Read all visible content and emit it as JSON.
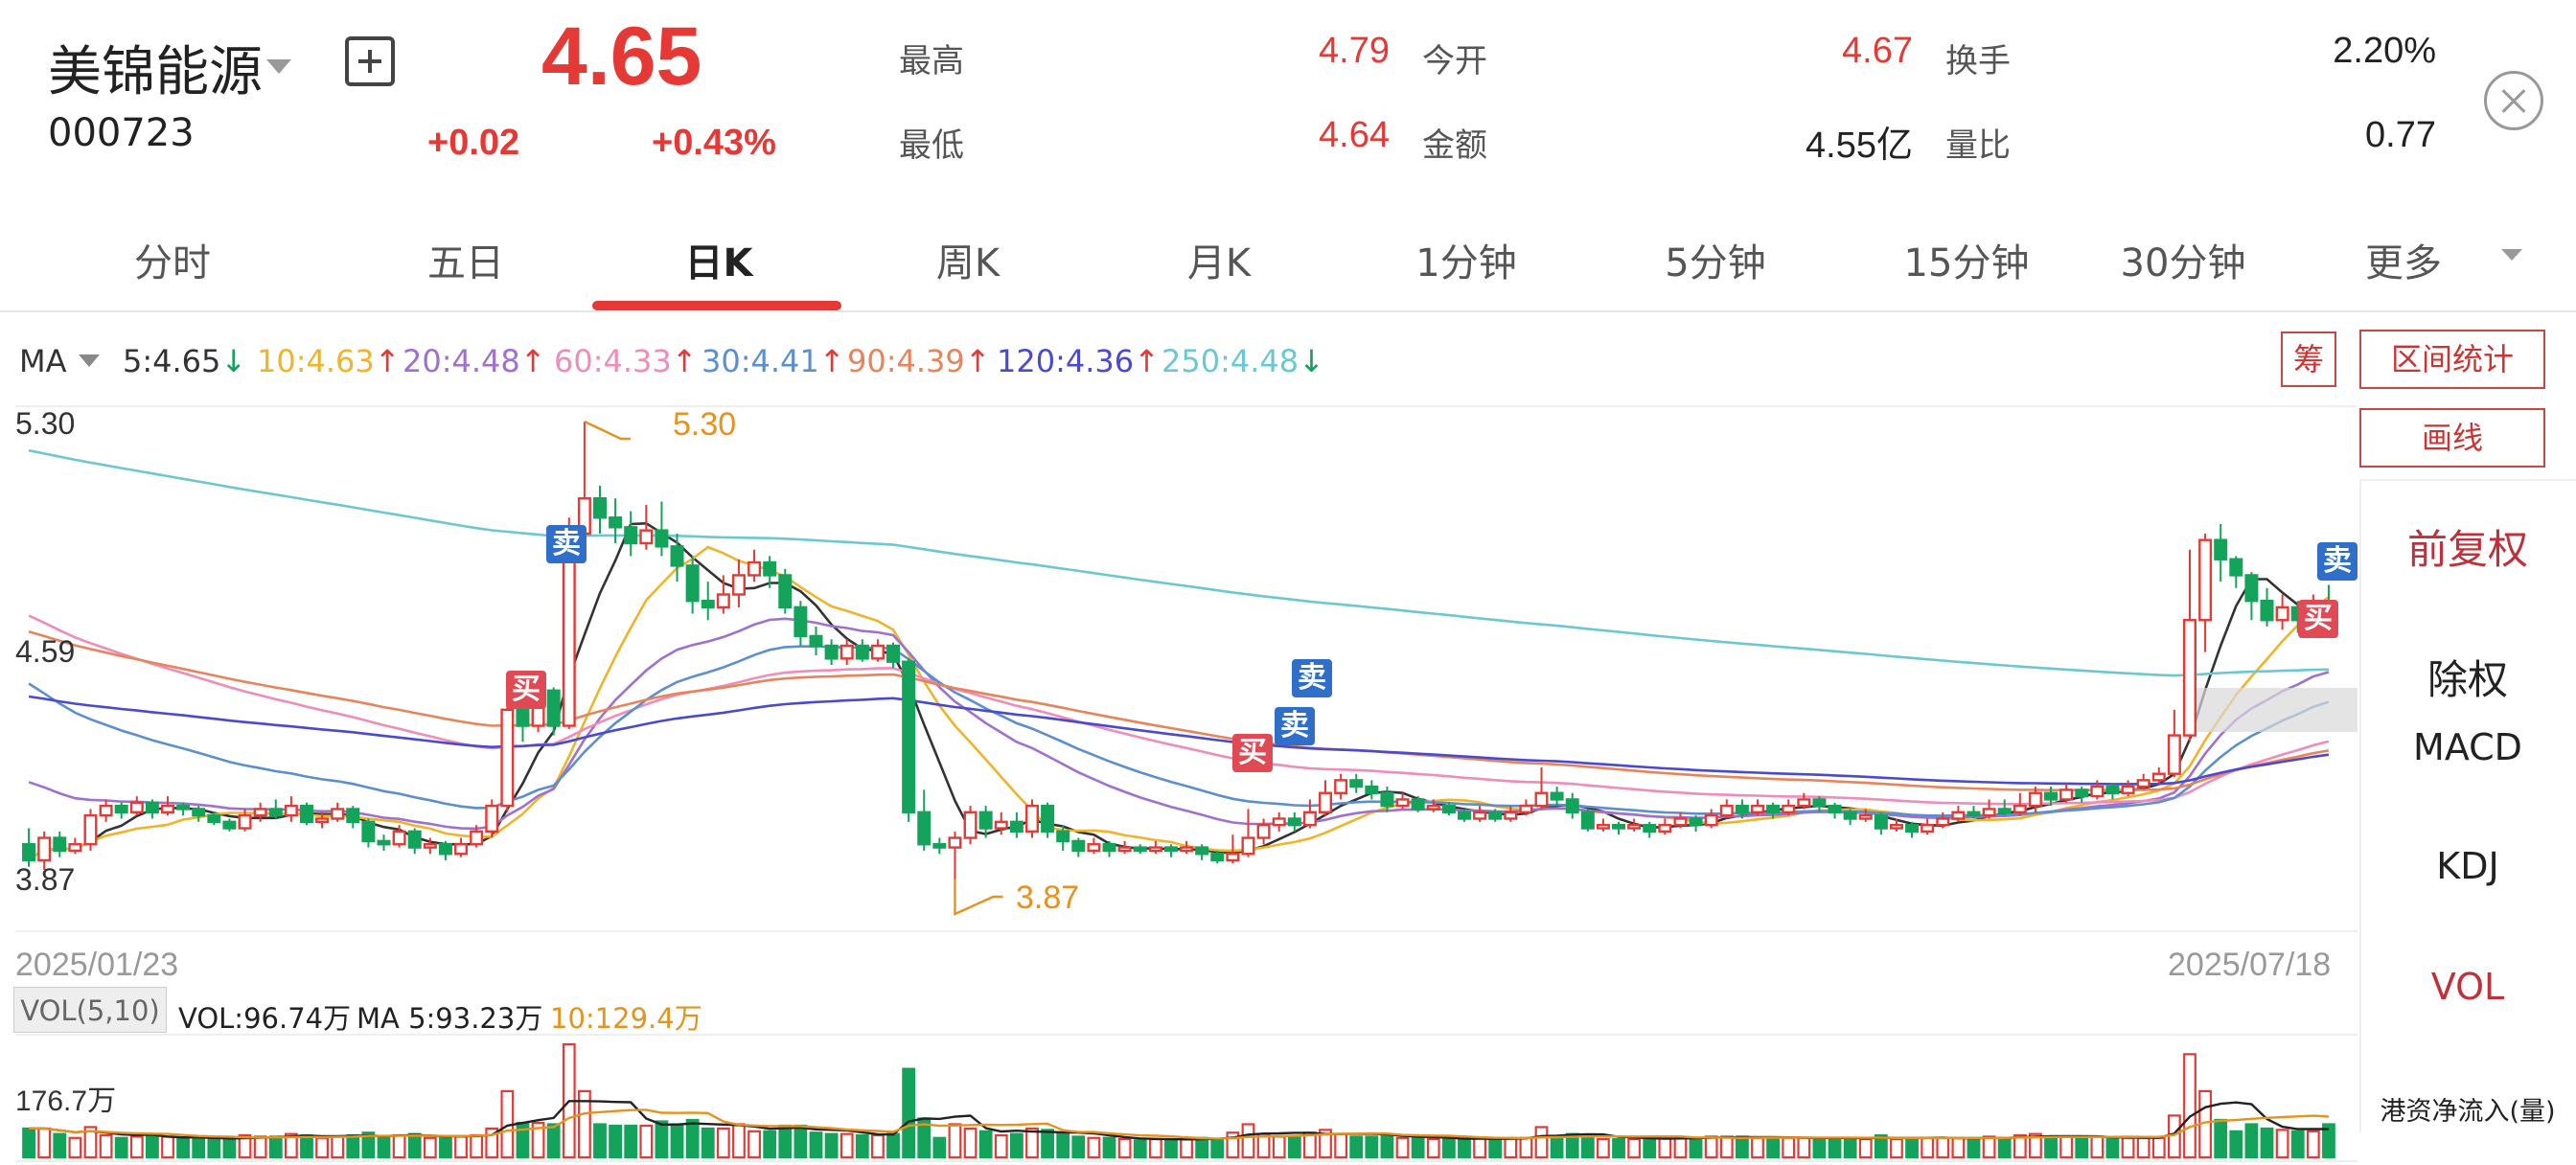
{
  "stock": {
    "name": "美锦能源",
    "code": "000723",
    "price": "4.65",
    "change": "+0.02",
    "change_pct": "+0.43%"
  },
  "stats": [
    {
      "label": "最高",
      "value": "4.79",
      "color": "#e53935"
    },
    {
      "label": "今开",
      "value": "4.67",
      "color": "#e53935"
    },
    {
      "label": "换手",
      "value": "2.20%",
      "color": "#222222"
    },
    {
      "label": "最低",
      "value": "4.64",
      "color": "#e53935"
    },
    {
      "label": "金额",
      "value": "4.55亿",
      "color": "#222222"
    },
    {
      "label": "量比",
      "value": "0.77",
      "color": "#222222"
    }
  ],
  "tabs": [
    "分时",
    "五日",
    "日K",
    "周K",
    "月K",
    "1分钟",
    "5分钟",
    "15分钟",
    "30分钟",
    "更多"
  ],
  "active_tab": "日K",
  "ma_legend": {
    "label": "MA",
    "items": [
      {
        "text": "5:4.65",
        "arrow": "↓",
        "color": "#333333",
        "arrow_color": "#13a35a"
      },
      {
        "text": "10:4.63",
        "arrow": "↑",
        "color": "#f0b429",
        "arrow_color": "#e53935"
      },
      {
        "text": "20:4.48",
        "arrow": "↑",
        "color": "#a070d0",
        "arrow_color": "#e53935"
      },
      {
        "text": "60:4.33",
        "arrow": "↑",
        "color": "#f08cb8",
        "arrow_color": "#e53935"
      },
      {
        "text": "30:4.41",
        "arrow": "↑",
        "color": "#5b8fd0",
        "arrow_color": "#e53935"
      },
      {
        "text": "90:4.39",
        "arrow": "↑",
        "color": "#e8845a",
        "arrow_color": "#e53935"
      },
      {
        "text": "120:4.36",
        "arrow": "↑",
        "color": "#4a4ad0",
        "arrow_color": "#e53935"
      },
      {
        "text": "250:4.48",
        "arrow": "↓",
        "color": "#6cc8d0",
        "arrow_color": "#13a35a"
      }
    ]
  },
  "side_buttons": {
    "chip": "筹",
    "range_stats": "区间统计",
    "draw": "画线"
  },
  "side_menu": [
    {
      "label": "前复权",
      "color": "#c0303a"
    },
    {
      "label": "除权",
      "color": "#222222"
    },
    {
      "label": "MACD",
      "color": "#222222"
    },
    {
      "label": "KDJ",
      "color": "#222222"
    },
    {
      "label": "VOL",
      "color": "#c0303a"
    },
    {
      "label": "港资净流入(量)",
      "color": "#222222"
    }
  ],
  "axis": {
    "y_top": "5.30",
    "y_mid": "4.59",
    "y_bottom": "3.87",
    "date_start": "2025/01/23",
    "date_end": "2025/07/18",
    "max_label": "5.30",
    "min_label": "3.87"
  },
  "volume": {
    "badge": "VOL(5,10)",
    "vol": "VOL:96.74万",
    "ma5": "MA 5:93.23万",
    "ma10": "10:129.4万",
    "y_label": "176.7万"
  },
  "markers": {
    "sell": "卖",
    "buy": "买"
  },
  "colors": {
    "up": "#e53935",
    "down": "#13a35a",
    "accent": "#e53935"
  },
  "chart_data": {
    "type": "candlestick",
    "date_range": [
      "2025/01/23",
      "2025/07/18"
    ],
    "ylim": [
      3.87,
      5.3
    ],
    "candles": [
      [
        3.98,
        3.93,
        4.03,
        3.91
      ],
      [
        3.93,
        4.0,
        4.02,
        3.9
      ],
      [
        4.0,
        3.96,
        4.02,
        3.94
      ],
      [
        3.96,
        3.98,
        4.0,
        3.95
      ],
      [
        3.98,
        4.07,
        4.09,
        3.96
      ],
      [
        4.07,
        4.1,
        4.12,
        4.05
      ],
      [
        4.1,
        4.08,
        4.11,
        4.06
      ],
      [
        4.08,
        4.11,
        4.13,
        4.07
      ],
      [
        4.11,
        4.08,
        4.12,
        4.06
      ],
      [
        4.08,
        4.1,
        4.13,
        4.07
      ],
      [
        4.1,
        4.09,
        4.11,
        4.07
      ],
      [
        4.09,
        4.07,
        4.1,
        4.05
      ],
      [
        4.07,
        4.05,
        4.08,
        4.04
      ],
      [
        4.05,
        4.03,
        4.06,
        4.02
      ],
      [
        4.03,
        4.07,
        4.09,
        4.02
      ],
      [
        4.07,
        4.09,
        4.11,
        4.05
      ],
      [
        4.09,
        4.07,
        4.12,
        4.06
      ],
      [
        4.07,
        4.1,
        4.13,
        4.05
      ],
      [
        4.1,
        4.05,
        4.11,
        4.04
      ],
      [
        4.05,
        4.06,
        4.08,
        4.03
      ],
      [
        4.06,
        4.09,
        4.11,
        4.05
      ],
      [
        4.09,
        4.05,
        4.1,
        4.03
      ],
      [
        4.05,
        3.99,
        4.06,
        3.97
      ],
      [
        3.99,
        3.98,
        4.01,
        3.96
      ],
      [
        3.98,
        4.02,
        4.04,
        3.97
      ],
      [
        4.02,
        3.97,
        4.03,
        3.95
      ],
      [
        3.97,
        3.98,
        4.0,
        3.95
      ],
      [
        3.98,
        3.95,
        3.99,
        3.93
      ],
      [
        3.95,
        3.98,
        4.0,
        3.94
      ],
      [
        3.98,
        4.02,
        4.04,
        3.97
      ],
      [
        4.02,
        4.1,
        4.12,
        4.0
      ],
      [
        4.1,
        4.4,
        4.45,
        4.08
      ],
      [
        4.4,
        4.35,
        4.46,
        4.3
      ],
      [
        4.35,
        4.46,
        4.49,
        4.33
      ],
      [
        4.46,
        4.35,
        4.47,
        4.32
      ],
      [
        4.35,
        4.95,
        5.0,
        4.34
      ],
      [
        4.95,
        5.06,
        5.3,
        4.93
      ],
      [
        5.06,
        5.0,
        5.1,
        4.95
      ],
      [
        5.0,
        4.97,
        5.06,
        4.92
      ],
      [
        4.97,
        4.92,
        5.02,
        4.88
      ],
      [
        4.92,
        4.96,
        5.04,
        4.9
      ],
      [
        4.96,
        4.91,
        5.05,
        4.88
      ],
      [
        4.91,
        4.85,
        4.95,
        4.8
      ],
      [
        4.85,
        4.74,
        4.88,
        4.7
      ],
      [
        4.74,
        4.72,
        4.8,
        4.68
      ],
      [
        4.72,
        4.76,
        4.82,
        4.7
      ],
      [
        4.76,
        4.82,
        4.87,
        4.72
      ],
      [
        4.82,
        4.86,
        4.9,
        4.8
      ],
      [
        4.86,
        4.82,
        4.88,
        4.78
      ],
      [
        4.82,
        4.72,
        4.84,
        4.7
      ],
      [
        4.72,
        4.63,
        4.74,
        4.6
      ],
      [
        4.63,
        4.6,
        4.66,
        4.57
      ],
      [
        4.6,
        4.56,
        4.62,
        4.54
      ],
      [
        4.56,
        4.6,
        4.62,
        4.54
      ],
      [
        4.6,
        4.56,
        4.62,
        4.55
      ],
      [
        4.56,
        4.6,
        4.62,
        4.55
      ],
      [
        4.6,
        4.55,
        4.61,
        4.53
      ],
      [
        4.55,
        4.08,
        4.56,
        4.05
      ],
      [
        4.08,
        3.98,
        4.15,
        3.96
      ],
      [
        3.98,
        3.97,
        4.0,
        3.95
      ],
      [
        3.97,
        4.0,
        4.02,
        3.87
      ],
      [
        4.0,
        4.08,
        4.1,
        3.98
      ],
      [
        4.08,
        4.03,
        4.1,
        4.0
      ],
      [
        4.03,
        4.05,
        4.08,
        4.01
      ],
      [
        4.05,
        4.02,
        4.08,
        4.0
      ],
      [
        4.02,
        4.1,
        4.12,
        4.0
      ],
      [
        4.1,
        4.02,
        4.11,
        4.0
      ],
      [
        4.02,
        3.99,
        4.04,
        3.96
      ],
      [
        3.99,
        3.96,
        4.0,
        3.94
      ],
      [
        3.96,
        3.98,
        4.0,
        3.95
      ],
      [
        3.98,
        3.96,
        3.99,
        3.94
      ],
      [
        3.96,
        3.97,
        3.99,
        3.95
      ],
      [
        3.97,
        3.96,
        3.98,
        3.95
      ],
      [
        3.96,
        3.97,
        3.99,
        3.95
      ],
      [
        3.97,
        3.96,
        3.98,
        3.94
      ],
      [
        3.96,
        3.97,
        3.99,
        3.95
      ],
      [
        3.97,
        3.95,
        3.98,
        3.93
      ],
      [
        3.95,
        3.93,
        3.96,
        3.92
      ],
      [
        3.93,
        3.95,
        4.01,
        3.92
      ],
      [
        3.95,
        4.0,
        4.09,
        3.94
      ],
      [
        4.0,
        4.04,
        4.06,
        3.98
      ],
      [
        4.04,
        4.06,
        4.08,
        4.02
      ],
      [
        4.06,
        4.04,
        4.08,
        4.02
      ],
      [
        4.04,
        4.08,
        4.12,
        4.03
      ],
      [
        4.08,
        4.14,
        4.18,
        4.07
      ],
      [
        4.14,
        4.18,
        4.2,
        4.12
      ],
      [
        4.18,
        4.16,
        4.2,
        4.14
      ],
      [
        4.16,
        4.14,
        4.18,
        4.12
      ],
      [
        4.14,
        4.1,
        4.16,
        4.08
      ],
      [
        4.1,
        4.12,
        4.14,
        4.09
      ],
      [
        4.12,
        4.09,
        4.13,
        4.08
      ],
      [
        4.09,
        4.1,
        4.12,
        4.08
      ],
      [
        4.1,
        4.08,
        4.11,
        4.07
      ],
      [
        4.08,
        4.06,
        4.09,
        4.05
      ],
      [
        4.06,
        4.08,
        4.1,
        4.05
      ],
      [
        4.08,
        4.06,
        4.09,
        4.05
      ],
      [
        4.06,
        4.08,
        4.1,
        4.05
      ],
      [
        4.08,
        4.1,
        4.12,
        4.07
      ],
      [
        4.1,
        4.14,
        4.22,
        4.09
      ],
      [
        4.14,
        4.12,
        4.16,
        4.1
      ],
      [
        4.12,
        4.08,
        4.14,
        4.06
      ],
      [
        4.08,
        4.03,
        4.09,
        4.02
      ],
      [
        4.03,
        4.04,
        4.06,
        4.02
      ],
      [
        4.04,
        4.03,
        4.05,
        4.01
      ],
      [
        4.03,
        4.04,
        4.06,
        4.02
      ],
      [
        4.04,
        4.02,
        4.05,
        4.0
      ],
      [
        4.02,
        4.04,
        4.06,
        4.01
      ],
      [
        4.04,
        4.06,
        4.08,
        4.03
      ],
      [
        4.06,
        4.04,
        4.07,
        4.02
      ],
      [
        4.04,
        4.07,
        4.09,
        4.03
      ],
      [
        4.07,
        4.1,
        4.12,
        4.06
      ],
      [
        4.1,
        4.08,
        4.12,
        4.06
      ],
      [
        4.08,
        4.1,
        4.12,
        4.07
      ],
      [
        4.1,
        4.08,
        4.11,
        4.06
      ],
      [
        4.08,
        4.1,
        4.12,
        4.07
      ],
      [
        4.1,
        4.12,
        4.14,
        4.09
      ],
      [
        4.12,
        4.1,
        4.13,
        4.08
      ],
      [
        4.1,
        4.08,
        4.11,
        4.06
      ],
      [
        4.08,
        4.06,
        4.09,
        4.04
      ],
      [
        4.06,
        4.07,
        4.09,
        4.05
      ],
      [
        4.07,
        4.03,
        4.08,
        4.01
      ],
      [
        4.03,
        4.04,
        4.06,
        4.02
      ],
      [
        4.04,
        4.02,
        4.05,
        4.0
      ],
      [
        4.02,
        4.04,
        4.06,
        4.01
      ],
      [
        4.04,
        4.06,
        4.08,
        4.03
      ],
      [
        4.06,
        4.08,
        4.1,
        4.05
      ],
      [
        4.08,
        4.07,
        4.1,
        4.06
      ],
      [
        4.07,
        4.09,
        4.12,
        4.06
      ],
      [
        4.09,
        4.08,
        4.12,
        4.07
      ],
      [
        4.08,
        4.1,
        4.14,
        4.07
      ],
      [
        4.1,
        4.14,
        4.16,
        4.08
      ],
      [
        4.14,
        4.12,
        4.16,
        4.1
      ],
      [
        4.12,
        4.15,
        4.17,
        4.11
      ],
      [
        4.15,
        4.13,
        4.16,
        4.11
      ],
      [
        4.13,
        4.16,
        4.18,
        4.12
      ],
      [
        4.16,
        4.14,
        4.17,
        4.12
      ],
      [
        4.14,
        4.16,
        4.18,
        4.13
      ],
      [
        4.16,
        4.18,
        4.2,
        4.15
      ],
      [
        4.18,
        4.2,
        4.22,
        4.17
      ],
      [
        4.2,
        4.32,
        4.4,
        4.19
      ],
      [
        4.32,
        4.68,
        4.9,
        4.3
      ],
      [
        4.68,
        4.93,
        4.95,
        4.58
      ],
      [
        4.93,
        4.87,
        4.98,
        4.8
      ],
      [
        4.87,
        4.82,
        4.88,
        4.78
      ],
      [
        4.82,
        4.74,
        4.83,
        4.68
      ],
      [
        4.74,
        4.68,
        4.78,
        4.66
      ],
      [
        4.68,
        4.72,
        4.76,
        4.65
      ],
      [
        4.72,
        4.68,
        4.74,
        4.64
      ],
      [
        4.68,
        4.74,
        4.76,
        4.66
      ],
      [
        4.67,
        4.65,
        4.79,
        4.64
      ]
    ],
    "volume_last": "96.74万",
    "volume_ma5": "93.23万",
    "volume_ma10": "129.4万",
    "volume_ylabel": "176.7万"
  }
}
